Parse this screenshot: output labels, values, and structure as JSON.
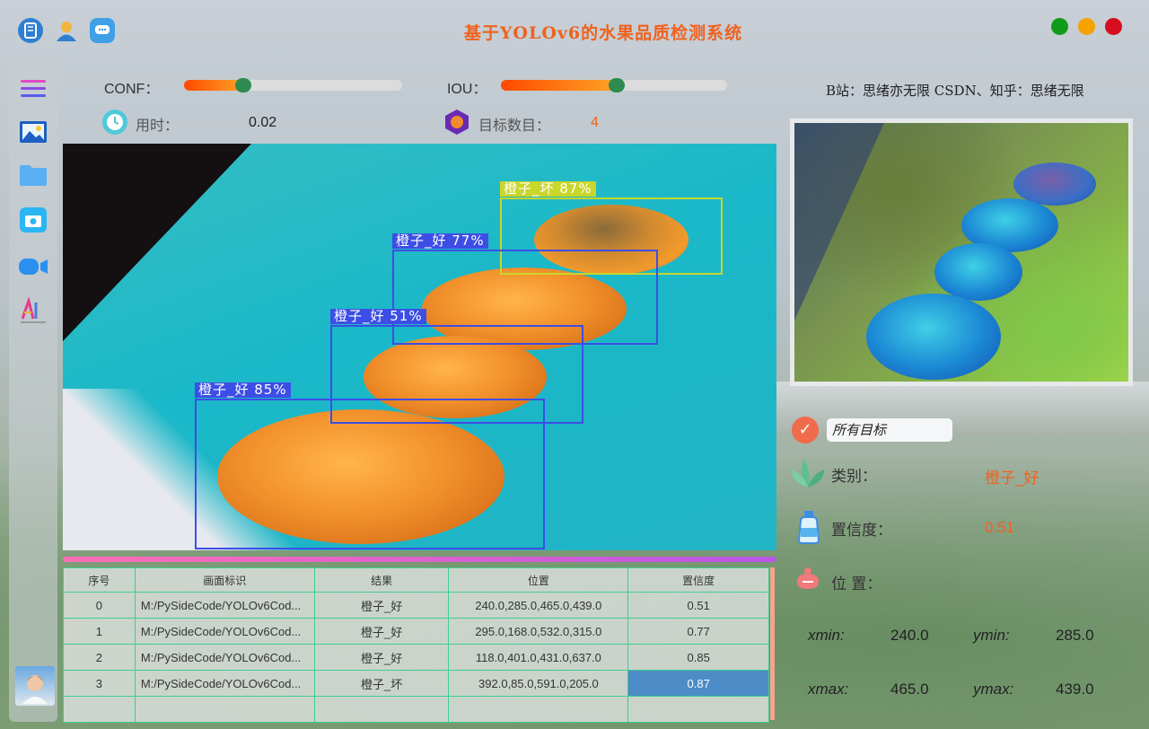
{
  "app": {
    "title": "基于YOLOv6的水果品质检测系统"
  },
  "credit": "B站：思绪亦无限  CSDN、知乎：思绪无限",
  "controls": {
    "conf_label": "CONF：",
    "conf_value": 0.27,
    "iou_label": "IOU：",
    "iou_value": 0.51,
    "time_label": "用时：",
    "time_value": "0.02",
    "count_label": "目标数目：",
    "count_value": "4"
  },
  "detections": [
    {
      "label": "橙子_坏  87%",
      "color": "#c9d62a"
    },
    {
      "label": "橙子_好  77%",
      "color": "#3d4ee6"
    },
    {
      "label": "橙子_好  51%",
      "color": "#3d4ee6"
    },
    {
      "label": "橙子_好  85%",
      "color": "#3d4ee6"
    }
  ],
  "table": {
    "headers": [
      "序号",
      "画面标识",
      "结果",
      "位置",
      "置信度"
    ],
    "rows": [
      [
        "0",
        "M:/PySideCode/YOLOv6Cod...",
        "橙子_好",
        "240.0,285.0,465.0,439.0",
        "0.51"
      ],
      [
        "1",
        "M:/PySideCode/YOLOv6Cod...",
        "橙子_好",
        "295.0,168.0,532.0,315.0",
        "0.77"
      ],
      [
        "2",
        "M:/PySideCode/YOLOv6Cod...",
        "橙子_好",
        "118.0,401.0,431.0,637.0",
        "0.85"
      ],
      [
        "3",
        "M:/PySideCode/YOLOv6Cod...",
        "橙子_坏",
        "392.0,85.0,591.0,205.0",
        "0.87"
      ]
    ],
    "selected_row": 3
  },
  "details": {
    "target_select": "所有目标",
    "class_label": "类别：",
    "class_value": "橙子_好",
    "conf_label": "置信度：",
    "conf_value": "0.51",
    "pos_label": "位 置：",
    "xmin_label": "xmin:",
    "xmin_value": "240.0",
    "ymin_label": "ymin:",
    "ymin_value": "285.0",
    "xmax_label": "xmax:",
    "xmax_value": "465.0",
    "ymax_label": "ymax:",
    "ymax_value": "439.0"
  },
  "colors": {
    "accent": "#f0611e",
    "win_green": "#119b1a",
    "win_yellow": "#f6a200",
    "win_red": "#d60d1f"
  }
}
